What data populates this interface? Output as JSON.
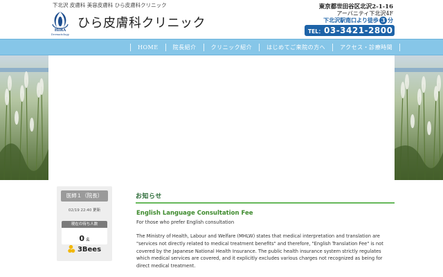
{
  "header": {
    "tagline": "下北沢 皮膚科 美容皮膚科 ひら皮膚科クリニック",
    "clinic_name": "ひら皮膚科クリニック",
    "logo_text": "HIRA",
    "logo_sub": "Dermatology",
    "address_line1": "東京都世田谷区北沢2-1-16",
    "address_line2": "アーバニティ下北沢4F",
    "station_prefix": "下北沢駅南口より徒歩",
    "station_minutes": "3",
    "station_suffix": "分",
    "tel_label": "TEL：",
    "tel_number": "03-3421-2800"
  },
  "nav": {
    "items": [
      {
        "label": "HOME"
      },
      {
        "label": "院長紹介"
      },
      {
        "label": "クリニック紹介"
      },
      {
        "label": "はじめてご来院の方へ"
      },
      {
        "label": "アクセス・診療時間"
      }
    ]
  },
  "sidebar": {
    "doctor_tab": "医師１（院長）",
    "updated": "02/19 22:40 更新",
    "waiting_label": "現在の待ち人数",
    "waiting_count": "0",
    "waiting_unit": "名",
    "brand": "3Bees"
  },
  "news": {
    "section_title": "お知らせ",
    "post_title": "English Language Consultation Fee",
    "post_subtitle": "For those who prefer English consultation",
    "post_body": "The Ministry of Health, Labour and Welfare (MHLW) states that medical interpretation and translation are \"services not directly related to medical treatment benefits\" and therefore, \"English Translation Fee\" is not covered by the Japanese National Health Insurance. The public health insurance system strictly regulates which medical services are covered, and it explicitly excludes various charges not recognized as being for direct medical treatment."
  },
  "colors": {
    "nav_bg": "#86c6e8",
    "brand_blue": "#1d63a8",
    "news_green": "#3d8a2c",
    "rule_green": "#66b85a"
  }
}
